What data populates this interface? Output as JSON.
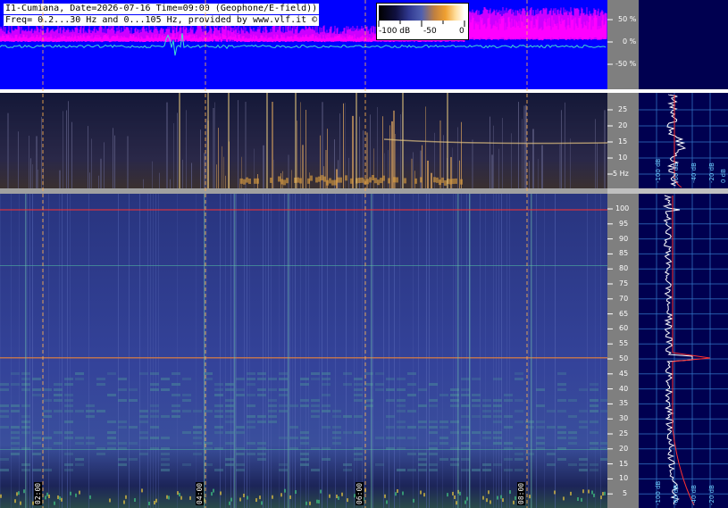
{
  "header": {
    "line1": "I1-Cumiana, Date=2026-07-16 Time=09:00 (Geophone/E-field))",
    "line2": "Freq= 0.2...30 Hz and 0...105 Hz, provided by www.vlf.it ©"
  },
  "colorbar": {
    "labels": [
      "-100 dB",
      "-50",
      "0"
    ]
  },
  "waveform_scale": {
    "labels": [
      "50 %",
      "0 %",
      "-50 %"
    ]
  },
  "elf_scale": {
    "labels": [
      "25",
      "20",
      "15",
      "10",
      "5 Hz"
    ]
  },
  "slf_scale": {
    "labels": [
      "100",
      "95",
      "90",
      "85",
      "80",
      "75",
      "70",
      "65",
      "60",
      "55",
      "50",
      "45",
      "40",
      "35",
      "30",
      "25",
      "20",
      "15",
      "10",
      "5"
    ]
  },
  "time_axis": {
    "labels": [
      "02:00",
      "04:00",
      "06:00",
      "08:00"
    ]
  },
  "spectrum_top": {
    "labels": [
      "-100 dB",
      "-60 dB",
      "-40 dB",
      "-20 dB",
      "0 dB"
    ]
  },
  "spectrum_bottom": {
    "labels": [
      "-100 dB",
      "-60 dB",
      "-40 dB",
      "-20 dB"
    ]
  },
  "colors": {
    "waveform_bg": "#0000ff",
    "waveform_trace": "#ff00ff",
    "waveform_center": "#40e0d0",
    "spectrogram_bg": "#2a3a8a",
    "scale_bg": "#808080",
    "spectrum_bg": "#000050",
    "marker_red": "#ff3030",
    "dashed_orange": "#ffb050"
  }
}
